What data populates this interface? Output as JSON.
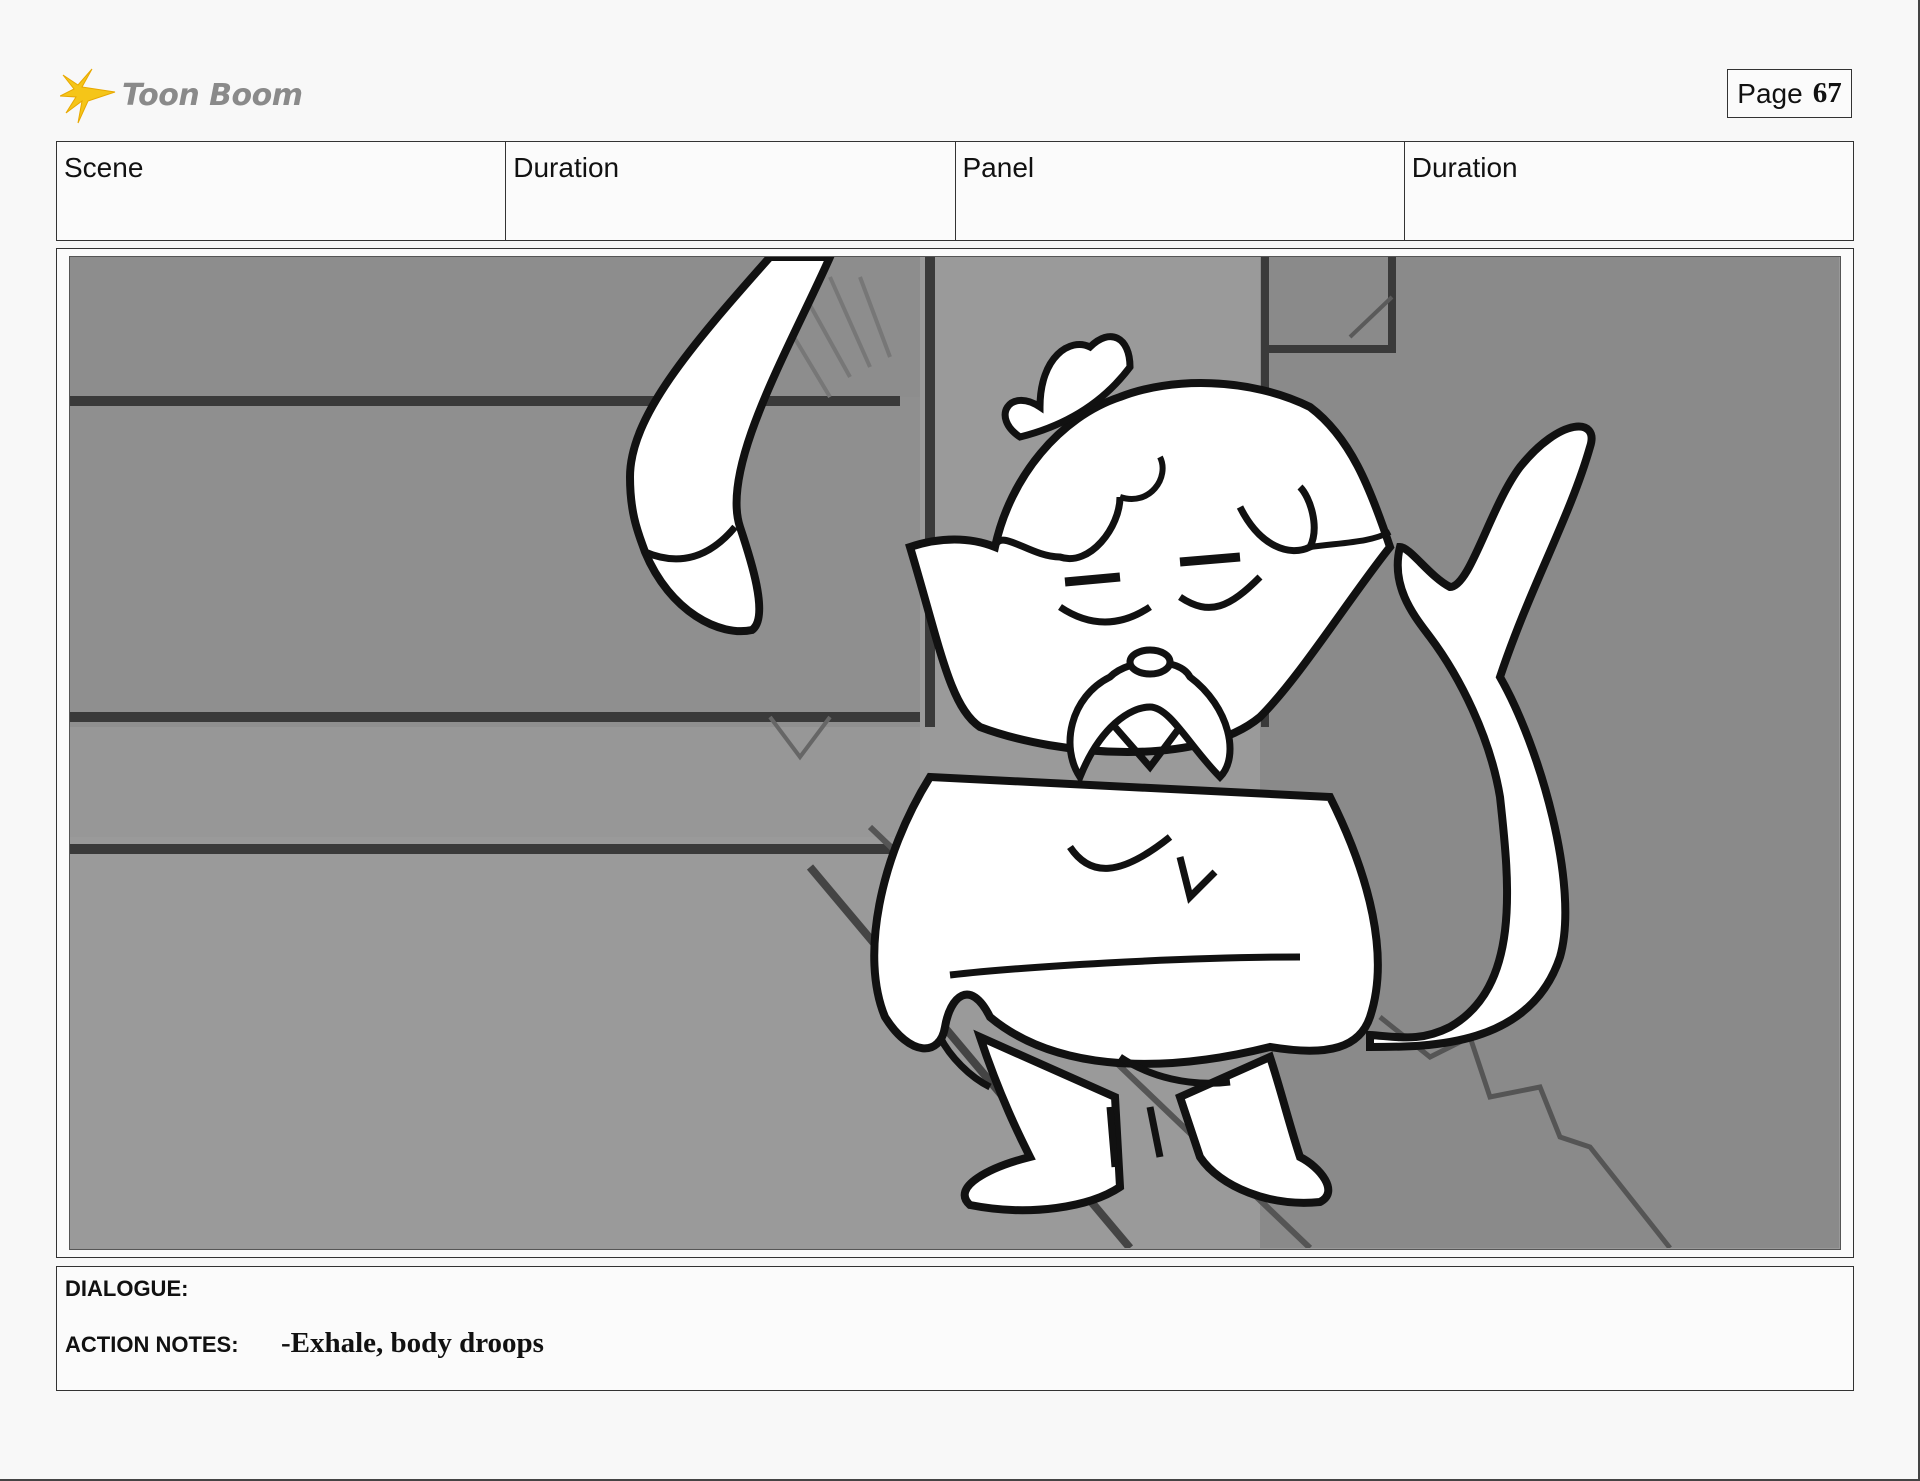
{
  "header": {
    "logo_text": "Toon Boom",
    "page_label": "Page",
    "page_number": "67"
  },
  "info_table": {
    "columns": [
      "Scene",
      "Duration",
      "Panel",
      "Duration"
    ]
  },
  "notes": {
    "dialogue_label": "DIALOGUE:",
    "dialogue_text": "",
    "action_label": "ACTION NOTES:",
    "action_text": "-Exhale, body droops"
  },
  "colors": {
    "logo_star": "#f5c518",
    "logo_text": "#8a8a8a",
    "panel_background": "#999999",
    "panel_back_wall": "#8e8e8e",
    "line_art": "#111111"
  }
}
